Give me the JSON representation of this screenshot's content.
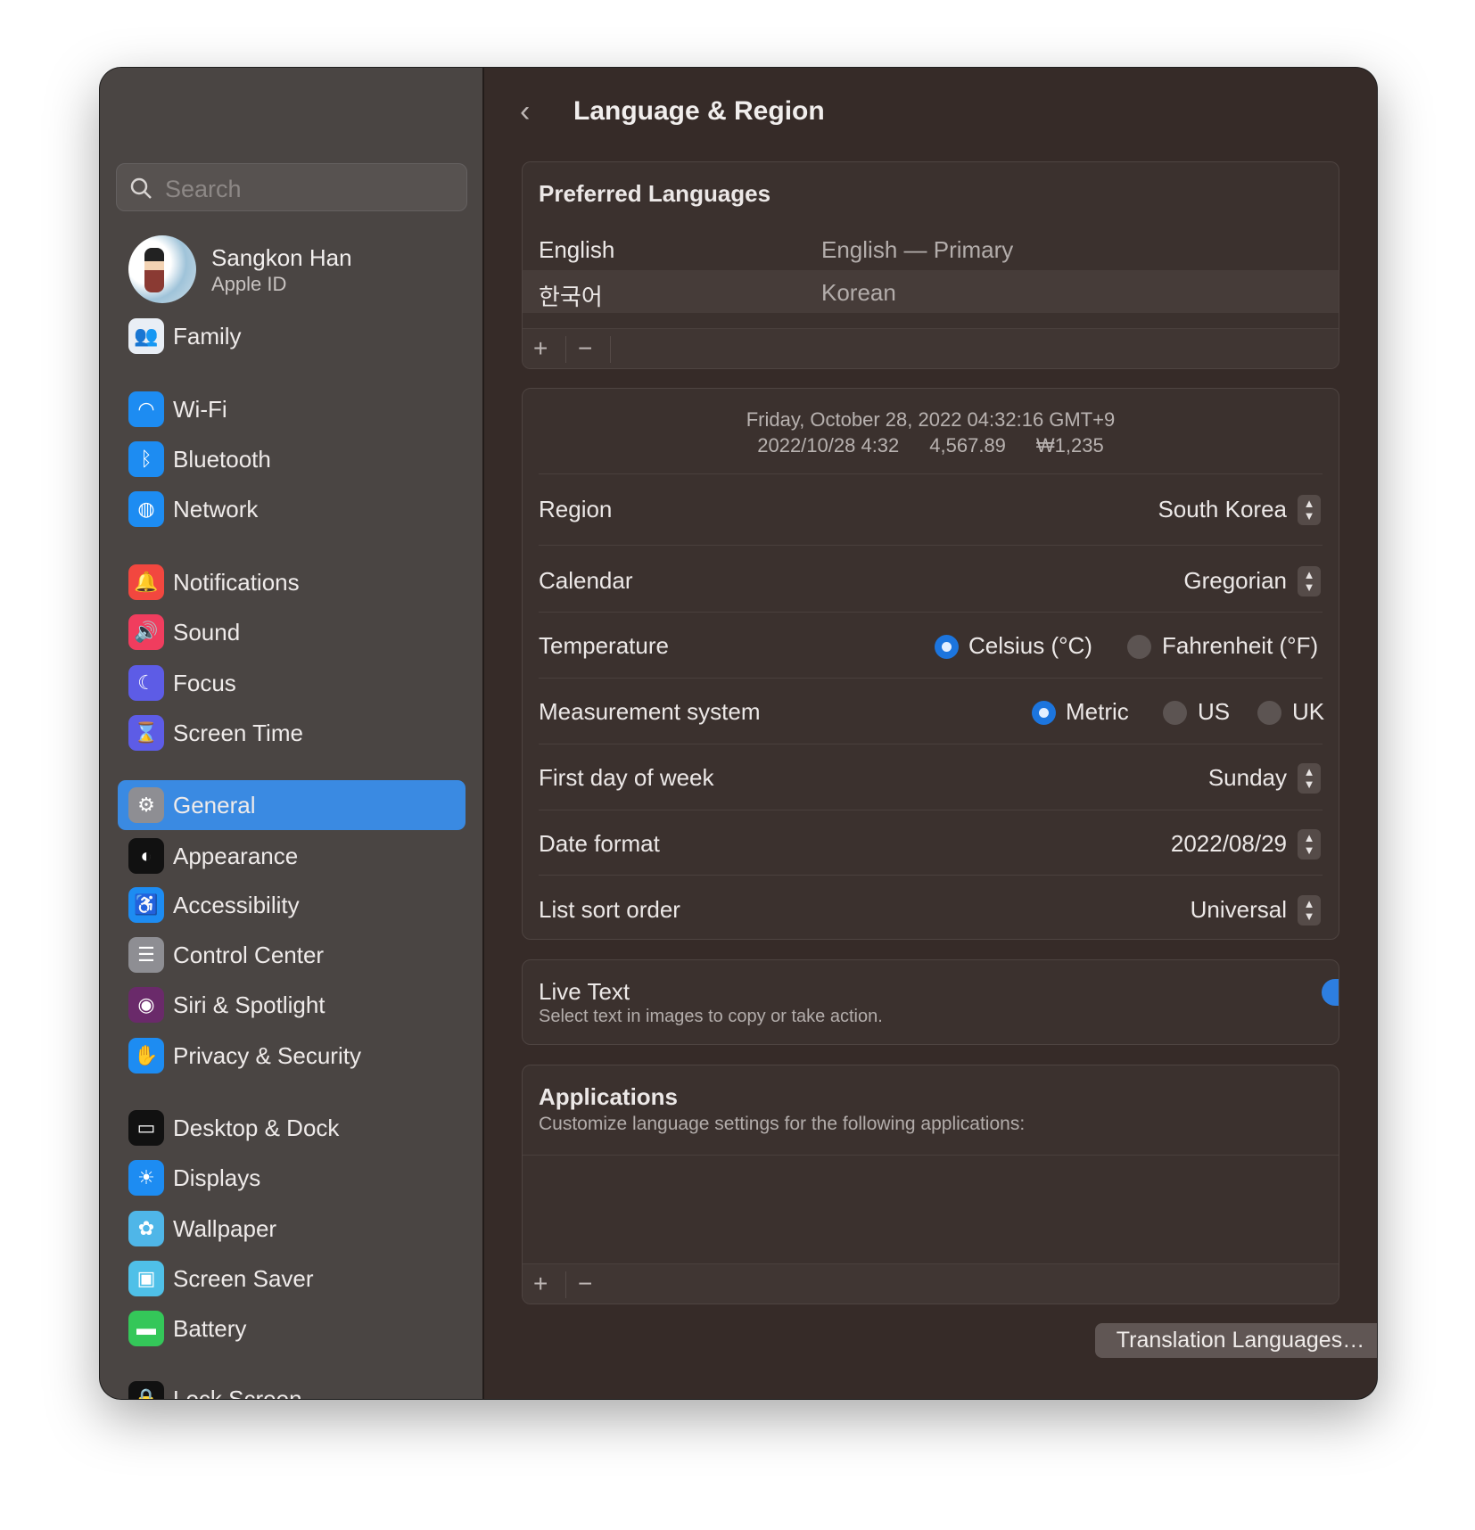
{
  "window": {
    "traffic_lights": {
      "close": "#fe5f57",
      "minimize": "#febc2e",
      "zoom": "#28c840"
    }
  },
  "sidebar": {
    "search_placeholder": "Search",
    "user": {
      "name": "Sangkon Han",
      "subtitle": "Apple ID"
    },
    "selected": "General",
    "items": [
      {
        "label": "Family",
        "icon": "family-icon",
        "color": "#e9eef5",
        "glyph": "👥"
      },
      {
        "label": "Wi-Fi",
        "icon": "wifi-icon",
        "color": "#1d8cf2",
        "glyph": "◠"
      },
      {
        "label": "Bluetooth",
        "icon": "bluetooth-icon",
        "color": "#1d8cf2",
        "glyph": "ᛒ"
      },
      {
        "label": "Network",
        "icon": "globe-icon",
        "color": "#1d8cf2",
        "glyph": "◍"
      },
      {
        "label": "Notifications",
        "icon": "bell-icon",
        "color": "#f2473f",
        "glyph": "🔔"
      },
      {
        "label": "Sound",
        "icon": "speaker-icon",
        "color": "#f03d5e",
        "glyph": "🔊"
      },
      {
        "label": "Focus",
        "icon": "moon-icon",
        "color": "#5d5ce6",
        "glyph": "☾"
      },
      {
        "label": "Screen Time",
        "icon": "hourglass-icon",
        "color": "#5d5ce6",
        "glyph": "⌛"
      },
      {
        "label": "General",
        "icon": "gear-icon",
        "color": "#8e8e93",
        "glyph": "⚙"
      },
      {
        "label": "Appearance",
        "icon": "appearance-icon",
        "color": "#111111",
        "glyph": "◐"
      },
      {
        "label": "Accessibility",
        "icon": "accessibility-icon",
        "color": "#1d8cf2",
        "glyph": "♿"
      },
      {
        "label": "Control Center",
        "icon": "control-center-icon",
        "color": "#8e8e93",
        "glyph": "☰"
      },
      {
        "label": "Siri & Spotlight",
        "icon": "siri-icon",
        "color": "#6a2a6a",
        "glyph": "◉"
      },
      {
        "label": "Privacy & Security",
        "icon": "hand-icon",
        "color": "#1d8cf2",
        "glyph": "✋"
      },
      {
        "label": "Desktop & Dock",
        "icon": "dock-icon",
        "color": "#111111",
        "glyph": "▭"
      },
      {
        "label": "Displays",
        "icon": "sun-icon",
        "color": "#1d8cf2",
        "glyph": "☀"
      },
      {
        "label": "Wallpaper",
        "icon": "flower-icon",
        "color": "#4fb6e8",
        "glyph": "✿"
      },
      {
        "label": "Screen Saver",
        "icon": "screen-saver-icon",
        "color": "#4fc0e8",
        "glyph": "▣"
      },
      {
        "label": "Battery",
        "icon": "battery-icon",
        "color": "#34c759",
        "glyph": "▬"
      },
      {
        "label": "Lock Screen",
        "icon": "lock-icon",
        "color": "#111111",
        "glyph": "🔒"
      }
    ]
  },
  "main": {
    "title": "Language & Region",
    "preferred": {
      "header": "Preferred Languages",
      "languages": [
        {
          "name": "English",
          "desc": "English — Primary"
        },
        {
          "name": "한국어",
          "desc": "Korean"
        }
      ],
      "add": "+",
      "remove": "−"
    },
    "format_preview": {
      "line1": "Friday, October 28, 2022 04:32:16 GMT+9",
      "date": "2022/10/28 4:32",
      "number": "4,567.89",
      "currency": "₩1,235"
    },
    "rows": {
      "region": {
        "label": "Region",
        "value": "South Korea"
      },
      "calendar": {
        "label": "Calendar",
        "value": "Gregorian"
      },
      "temperature": {
        "label": "Temperature",
        "options": [
          "Celsius (°C)",
          "Fahrenheit (°F)"
        ],
        "selected": "Celsius (°C)"
      },
      "measurement": {
        "label": "Measurement system",
        "options": [
          "Metric",
          "US",
          "UK"
        ],
        "selected": "Metric"
      },
      "first_day": {
        "label": "First day of week",
        "value": "Sunday"
      },
      "date_format": {
        "label": "Date format",
        "value": "2022/08/29"
      },
      "sort_order": {
        "label": "List sort order",
        "value": "Universal"
      }
    },
    "live_text": {
      "title": "Live Text",
      "subtitle": "Select text in images to copy or take action.",
      "enabled": true
    },
    "applications": {
      "title": "Applications",
      "subtitle": "Customize language settings for the following applications:",
      "add": "+",
      "remove": "−"
    },
    "translation_button": "Translation Languages…",
    "help": "?"
  }
}
